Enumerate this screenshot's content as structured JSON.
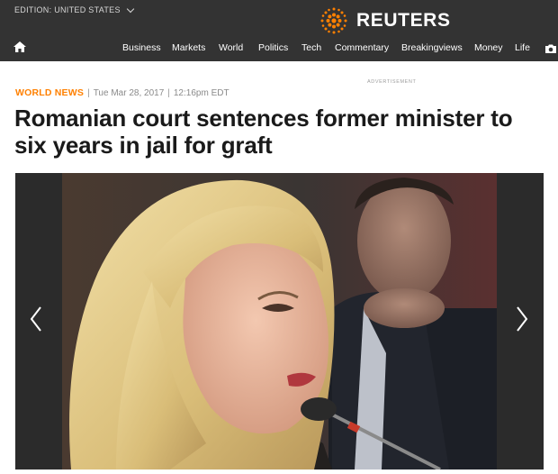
{
  "header": {
    "edition_label": "EDITION: UNITED STATES",
    "logo_text": "REUTERS",
    "brand_color": "#ff8000",
    "nav_items": [
      "Business",
      "Markets",
      "World",
      "Politics",
      "Tech",
      "Commentary",
      "Breakingviews",
      "Money",
      "Life"
    ]
  },
  "article": {
    "section": "WORLD NEWS",
    "separator": "|",
    "date": "Tue Mar 28, 2017",
    "time": "12:16pm EDT",
    "advertisement_label": "ADVERTISEMENT",
    "headline_line1": "Romanian court sentences former minister to",
    "headline_line2": "six years in jail for graft"
  },
  "slideshow": {
    "prev_icon": "chevron-left-icon",
    "next_icon": "chevron-right-icon"
  }
}
